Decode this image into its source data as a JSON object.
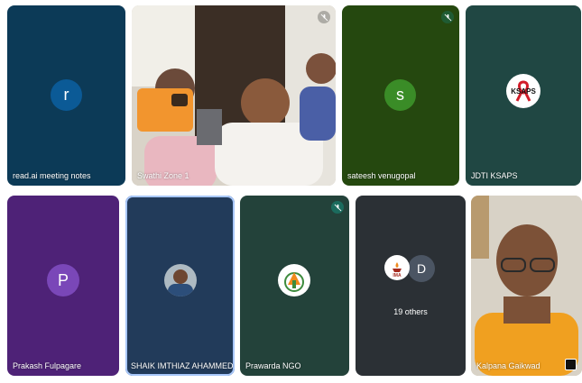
{
  "participants": [
    {
      "name": "read.ai meeting notes",
      "initial": "r",
      "bg": "#0c3a57",
      "avatar_bg": "#0b5a96"
    },
    {
      "name": "Swathi Zone 1",
      "type": "video"
    },
    {
      "name": "sateesh venugopal",
      "initial": "s",
      "bg": "#25480f",
      "avatar_bg": "#3a8c27"
    },
    {
      "name": "JDTI KSAPS",
      "logo_text": "KSAPS",
      "bg": "#204743"
    },
    {
      "name": "Prakash Fulpagare",
      "initial": "P",
      "bg": "#4e2277",
      "avatar_bg": "#7a47b8"
    },
    {
      "name": "SHAIK IMTHIAZ AHAMMED",
      "bg": "#223b5a"
    },
    {
      "name": "Prawarda NGO",
      "bg": "#23423a"
    },
    {
      "name": "Kalpana Gaikwad",
      "type": "video"
    }
  ],
  "others": {
    "count_label": "19 others",
    "initial": "D",
    "logo_text": "IMA"
  },
  "colors": {
    "accent_border": "#a8c7fa",
    "muted_mic": "#1b6b5d"
  }
}
